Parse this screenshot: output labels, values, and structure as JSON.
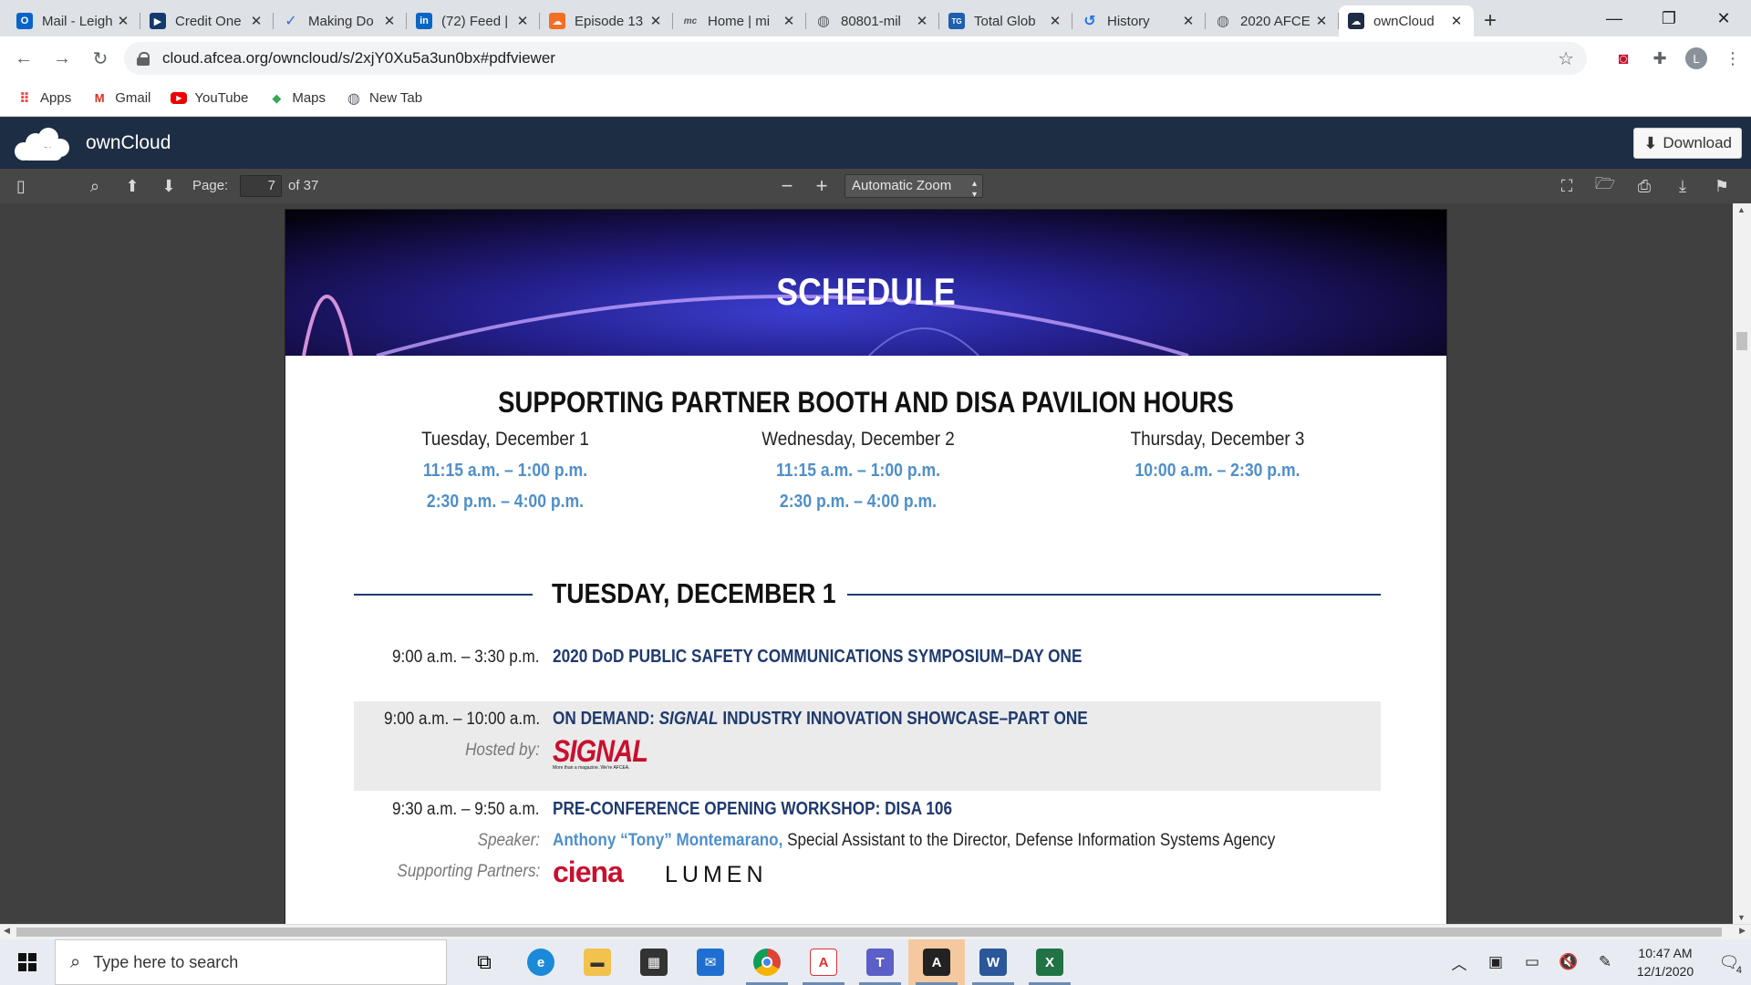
{
  "browser": {
    "tabs": [
      {
        "label": "Mail - Leigh",
        "icon": "outlook-icon",
        "color": "#0a64c8"
      },
      {
        "label": "Credit One",
        "icon": "credit-one-icon",
        "color": "#123a6e"
      },
      {
        "label": "Making Do",
        "icon": "checkmark-icon",
        "color": "#2f6fd0"
      },
      {
        "label": "(72) Feed |",
        "icon": "linkedin-icon",
        "color": "#0a66c2"
      },
      {
        "label": "Episode 13",
        "icon": "soundcloud-icon",
        "color": "#f26f23"
      },
      {
        "label": "Home | mi",
        "icon": "mc-icon",
        "color": "#555555"
      },
      {
        "label": "80801-mil",
        "icon": "globe-icon",
        "color": "#5f6368"
      },
      {
        "label": "Total Glob",
        "icon": "total-global-icon",
        "color": "#1f5fae"
      },
      {
        "label": "History",
        "icon": "history-icon",
        "color": "#1a73e8"
      },
      {
        "label": "2020 AFCE",
        "icon": "globe-icon",
        "color": "#5f6368"
      },
      {
        "label": "ownCloud",
        "icon": "owncloud-icon",
        "color": "#1d2d44"
      }
    ],
    "address": "cloud.afcea.org/owncloud/s/2xjY0Xu5a3un0bx#pdfviewer",
    "profile_initial": "L",
    "bookmarks": [
      {
        "label": "Apps",
        "icon": "apps-grid-icon"
      },
      {
        "label": "Gmail",
        "icon": "gmail-icon"
      },
      {
        "label": "YouTube",
        "icon": "youtube-icon"
      },
      {
        "label": "Maps",
        "icon": "maps-icon"
      },
      {
        "label": "New Tab",
        "icon": "globe-icon"
      }
    ]
  },
  "owncloud": {
    "name": "ownCloud",
    "download_label": "Download"
  },
  "pdf_toolbar": {
    "page_label": "Page:",
    "current_page": "7",
    "of_total": "of 37",
    "zoom": "Automatic Zoom"
  },
  "document": {
    "banner_title": "SCHEDULE",
    "booth_heading": "SUPPORTING PARTNER BOOTH AND DISA PAVILION HOURS",
    "days": [
      {
        "day": "Tuesday, December 1",
        "slots": [
          "11:15 a.m. – 1:00 p.m.",
          "2:30 p.m. – 4:00 p.m."
        ]
      },
      {
        "day": "Wednesday, December 2",
        "slots": [
          "11:15 a.m. – 1:00 p.m.",
          "2:30 p.m. – 4:00 p.m."
        ]
      },
      {
        "day": "Thursday, December 3",
        "slots": [
          "10:00 a.m. – 2:30 p.m."
        ]
      }
    ],
    "section_heading": "TUESDAY, DECEMBER 1",
    "events": [
      {
        "time": "9:00 a.m. – 3:30 p.m.",
        "title": "2020 DoD PUBLIC SAFETY COMMUNICATIONS SYMPOSIUM–DAY ONE"
      },
      {
        "time": "9:00 a.m. – 10:00 a.m.",
        "title_prefix": "ON DEMAND:",
        "title_italic": "SIGNAL",
        "title_suffix": "INDUSTRY INNOVATION SHOWCASE–PART ONE",
        "hosted_label": "Hosted by:",
        "logo_text": "SIGNAL",
        "logo_tagline": "More than a magazine. We're AFCEA."
      },
      {
        "time": "9:30 a.m. – 9:50 a.m.",
        "title": "PRE-CONFERENCE OPENING WORKSHOP: DISA 106",
        "speaker_label": "Speaker:",
        "speaker_name": "Anthony “Tony” Montemarano,",
        "speaker_desc": "Special Assistant to the Director, Defense Information Systems Agency",
        "partners_label": "Supporting Partners:",
        "partner_1": "ciena",
        "partner_2": "LUMEN"
      }
    ]
  },
  "taskbar": {
    "search_placeholder": "Type here to search",
    "time": "10:47 AM",
    "date": "12/1/2020",
    "notification_count": "4"
  }
}
